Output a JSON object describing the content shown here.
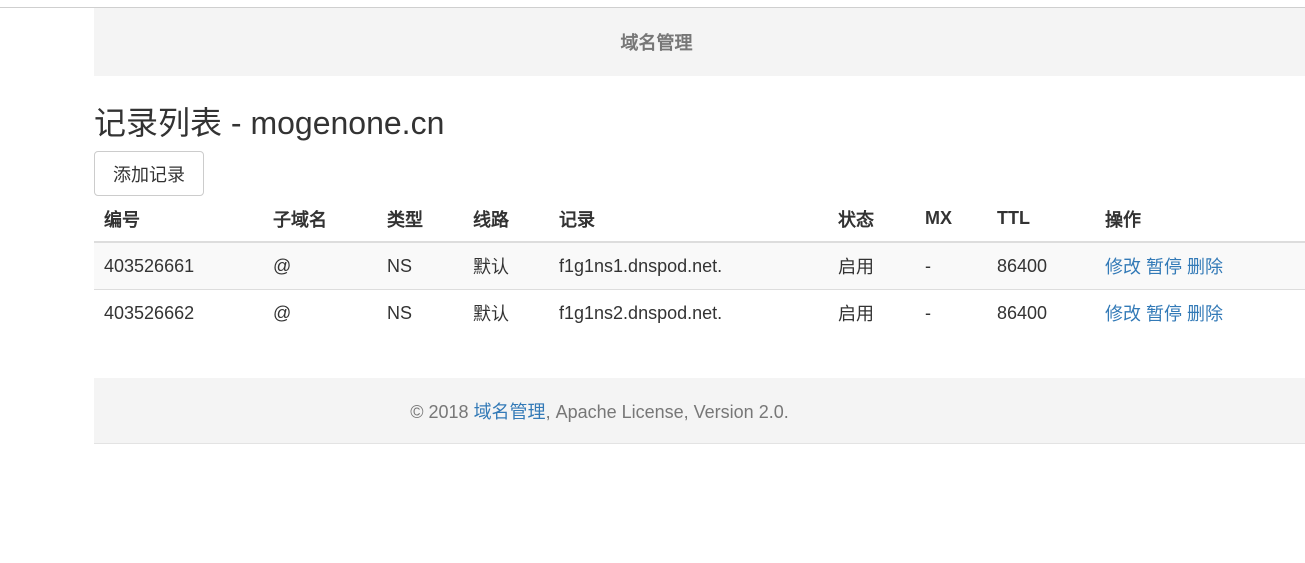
{
  "header": {
    "title": "域名管理"
  },
  "page": {
    "title": "记录列表 - mogenone.cn"
  },
  "toolbar": {
    "add_label": "添加记录"
  },
  "table": {
    "columns": [
      "编号",
      "子域名",
      "类型",
      "线路",
      "记录",
      "状态",
      "MX",
      "TTL",
      "操作"
    ],
    "rows": [
      {
        "id": "403526661",
        "subdomain": "@",
        "type": "NS",
        "line": "默认",
        "record": "f1g1ns1.dnspod.net.",
        "status": "启用",
        "mx": "-",
        "ttl": "86400",
        "actions": {
          "edit": "修改",
          "pause": "暂停",
          "delete": "删除"
        }
      },
      {
        "id": "403526662",
        "subdomain": "@",
        "type": "NS",
        "line": "默认",
        "record": "f1g1ns2.dnspod.net.",
        "status": "启用",
        "mx": "-",
        "ttl": "86400",
        "actions": {
          "edit": "修改",
          "pause": "暂停",
          "delete": "删除"
        }
      }
    ]
  },
  "footer": {
    "prefix": "© 2018 ",
    "link_label": "域名管理",
    "suffix": ", Apache License, Version 2.0."
  },
  "colors": {
    "link": "#337ab7",
    "header_bg": "#f4f4f4",
    "muted_text": "#777777"
  }
}
